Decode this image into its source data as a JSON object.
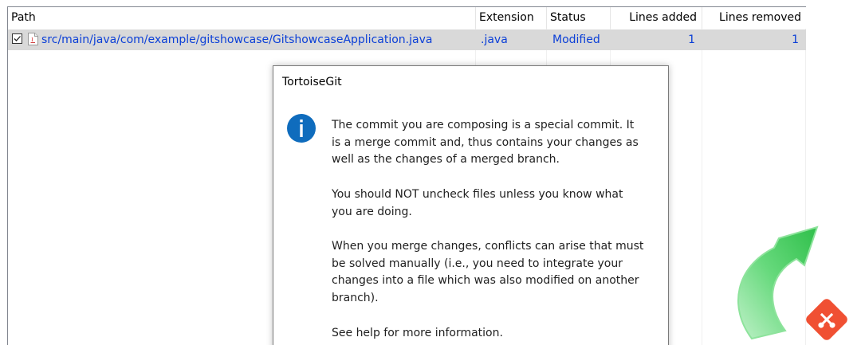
{
  "columns": {
    "path": "Path",
    "extension": "Extension",
    "status": "Status",
    "lines_added": "Lines added",
    "lines_removed": "Lines removed"
  },
  "files": [
    {
      "checked": true,
      "path": "src/main/java/com/example/gitshowcase/GitshowcaseApplication.java",
      "extension": ".java",
      "status": "Modified",
      "lines_added": "1",
      "lines_removed": "1"
    }
  ],
  "dialog": {
    "title": "TortoiseGit",
    "icon": "info-icon",
    "paragraphs": [
      [
        "The commit you are composing is a special commit. It",
        "is a merge commit and, thus contains your changes as",
        "well as the changes of a merged branch."
      ],
      [
        "You should NOT uncheck files unless you know what",
        "you are doing."
      ],
      [
        "When you merge changes, conflicts can arise that must",
        "be solved manually (i.e., you need to integrate your",
        "changes into a file which was also modified on another",
        "branch)."
      ],
      [
        "See help for more information."
      ]
    ]
  },
  "colors": {
    "link_text": "#0b3fd7",
    "row_highlight": "#d9d9d9",
    "info_blue": "#0f6cbd",
    "logo_green": "#4fd068",
    "git_orange": "#f05033"
  }
}
